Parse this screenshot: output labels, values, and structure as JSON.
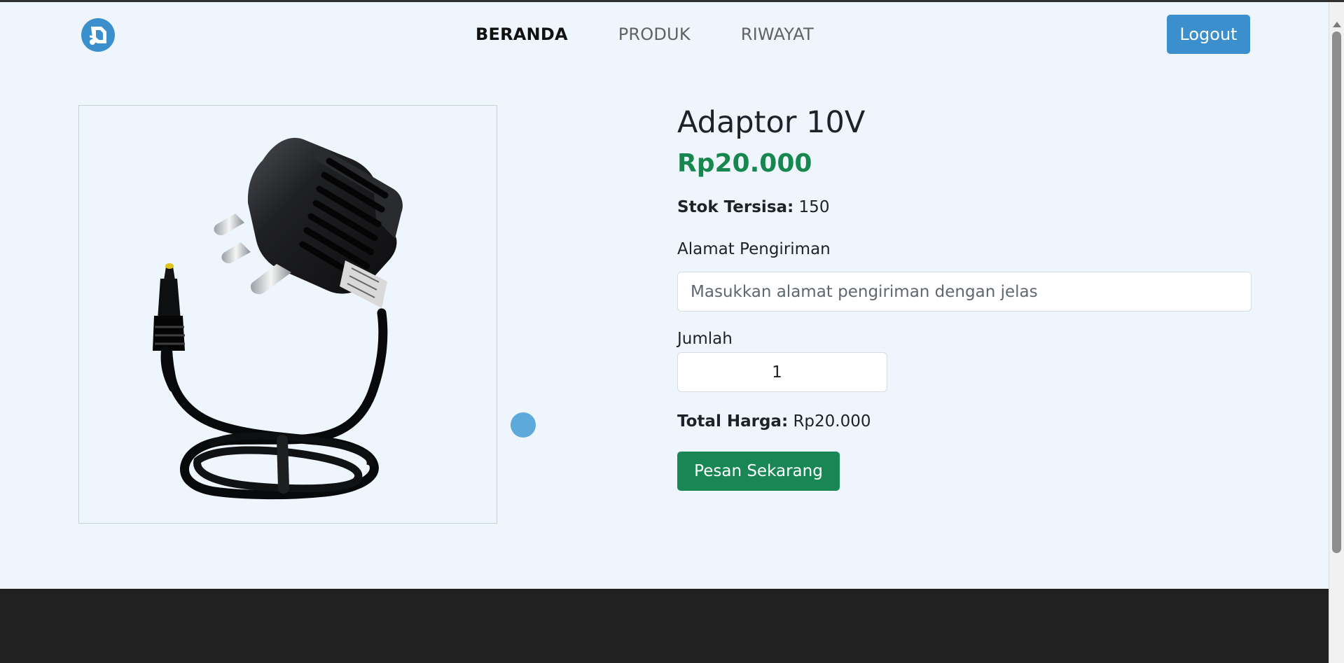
{
  "brand": {
    "logo_icon": "logo-icon",
    "accent_color": "#3b8fcc"
  },
  "nav": {
    "items": [
      {
        "label": "BERANDA",
        "active": true
      },
      {
        "label": "PRODUK",
        "active": false
      },
      {
        "label": "RIWAYAT",
        "active": false
      }
    ],
    "logout_label": "Logout"
  },
  "product": {
    "image_icon": "power-adapter-image",
    "title": "Adaptor 10V",
    "price": "Rp20.000",
    "stock_label": "Stok Tersisa:",
    "stock_value": "150"
  },
  "form": {
    "address_label": "Alamat Pengiriman",
    "address_placeholder": "Masukkan alamat pengiriman dengan jelas",
    "address_value": "",
    "quantity_label": "Jumlah",
    "quantity_value": "1",
    "total_label": "Total Harga:",
    "total_value": "Rp20.000",
    "submit_label": "Pesan Sekarang"
  },
  "colors": {
    "page_background": "#eef5fd",
    "price": "#18864f",
    "order_button": "#198754",
    "footer": "#212121",
    "cursor_dot": "#5ea9dc"
  }
}
